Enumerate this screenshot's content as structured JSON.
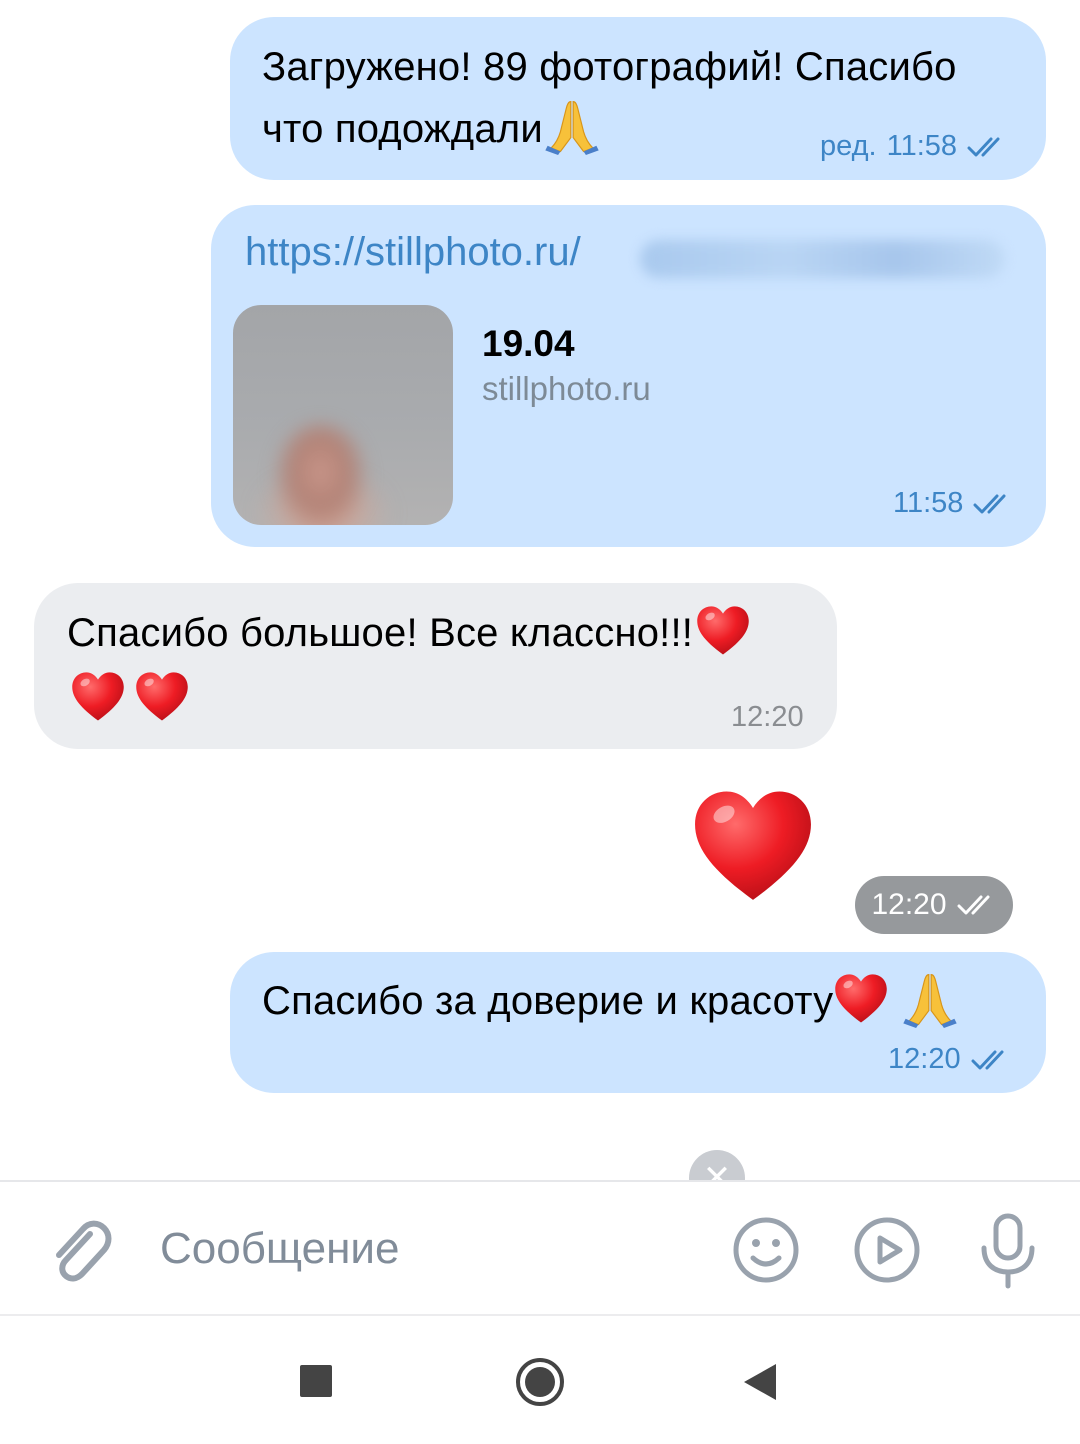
{
  "messages": [
    {
      "direction": "out",
      "text_line1": "Загружено! 89 фотографий! Спасибо",
      "text_line2": "что подождали",
      "emoji": "pray",
      "edited_label": "ред.",
      "time": "11:58",
      "status": "read"
    },
    {
      "direction": "out",
      "type": "link",
      "url_visible": "https://stillphoto.ru/",
      "preview_title": "19.04",
      "preview_site": "stillphoto.ru",
      "time": "11:58",
      "status": "read"
    },
    {
      "direction": "in",
      "text_line1": "Спасибо большое! Все классно!!!",
      "emoji": "heart ×3",
      "time": "12:20"
    },
    {
      "direction": "out",
      "type": "sticker-emoji",
      "emoji": "heart",
      "time": "12:20",
      "status": "read"
    },
    {
      "direction": "out",
      "text_line1": "Спасибо за доверие и красоту",
      "emoji": "heart, pray",
      "time": "12:20",
      "status": "read"
    }
  ],
  "composer": {
    "placeholder": "Сообщение",
    "icons": [
      "paperclip-icon",
      "smile-icon",
      "play-circle-icon",
      "microphone-icon"
    ]
  },
  "navigation": {
    "icons": [
      "recents-square-icon",
      "home-circle-icon",
      "back-triangle-icon"
    ]
  },
  "colors": {
    "outgoing_bubble": "#cce4ff",
    "incoming_bubble": "#ebedf0",
    "accent": "#3d85c6",
    "meta_gray": "#8a8d91",
    "heart_red": "#e8212e"
  }
}
